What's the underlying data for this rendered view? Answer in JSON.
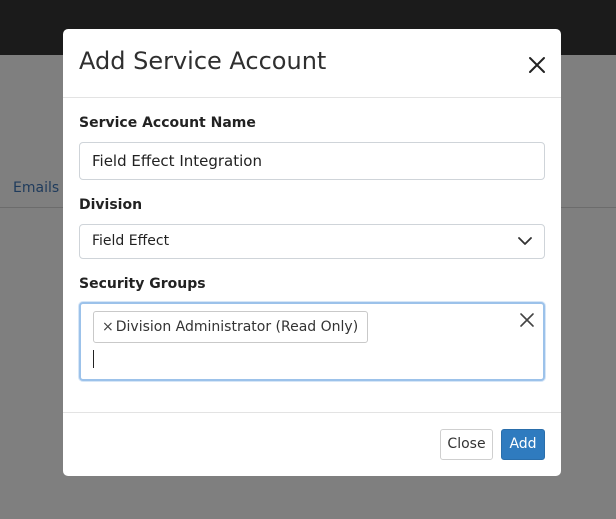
{
  "page": {
    "tab_label": "Emails"
  },
  "modal": {
    "title": "Add Service Account",
    "close_icon": "close-icon",
    "fields": {
      "name": {
        "label": "Service Account Name",
        "value": "Field Effect Integration"
      },
      "division": {
        "label": "Division",
        "selected": "Field Effect",
        "icon": "chevron-down-icon"
      },
      "security_groups": {
        "label": "Security Groups",
        "tags": [
          {
            "remove_symbol": "×",
            "label": "Division Administrator (Read Only)"
          }
        ],
        "clear_icon": "clear-icon"
      }
    },
    "footer": {
      "close_label": "Close",
      "add_label": "Add"
    }
  },
  "colors": {
    "backdrop": "#7f7f7f",
    "topbar": "#1b1b1b",
    "primary": "#2f7bbf",
    "focus_ring": "#9cc2ea"
  }
}
